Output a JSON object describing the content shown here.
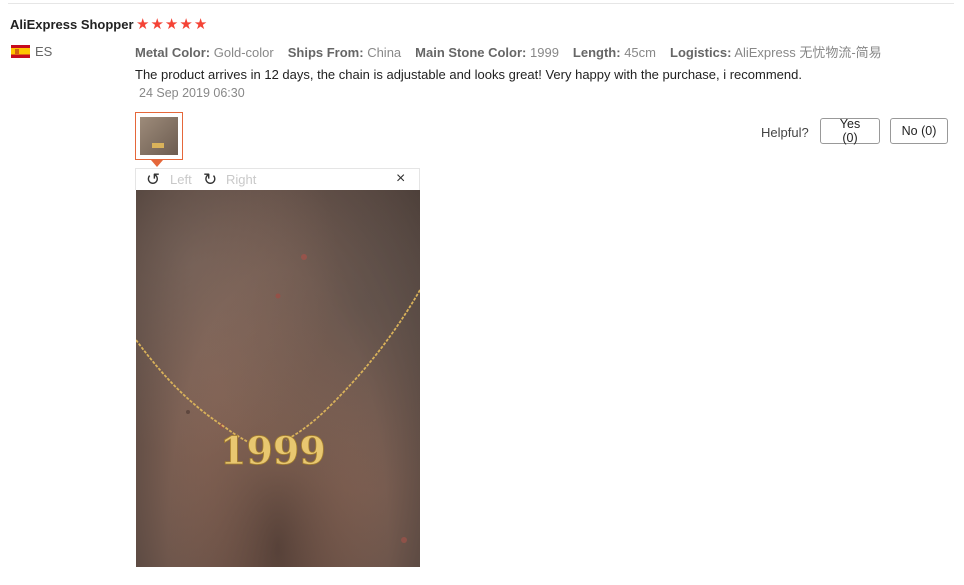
{
  "review": {
    "user_name": "AliExpress Shopper",
    "rating": 5,
    "country": "ES",
    "attributes": [
      {
        "key": "Metal Color:",
        "value": "Gold-color"
      },
      {
        "key": "Ships From:",
        "value": "China"
      },
      {
        "key": "Main Stone Color:",
        "value": "1999"
      },
      {
        "key": "Length:",
        "value": "45cm"
      },
      {
        "key": "Logistics:",
        "value": "AliExpress 无忧物流-简易"
      }
    ],
    "text": "The product arrives in 12 days, the chain is adjustable and looks great! Very happy with the purchase, i recommend.",
    "date": "24 Sep 2019 06:30"
  },
  "helpful": {
    "label": "Helpful?",
    "yes_label": "Yes (0)",
    "no_label": "No (0)"
  },
  "viewer": {
    "rotate_left_label": "Left",
    "rotate_right_label": "Right",
    "close_glyph": "×",
    "pendant_text": "1999"
  },
  "icons": {
    "star": "star-icon",
    "flag": "spain-flag-icon",
    "rotate_left": "rotate-left-icon",
    "rotate_right": "rotate-right-icon",
    "close": "close-icon"
  },
  "colors": {
    "star": "#f44336",
    "thumb_border": "#e5673a",
    "muted_label": "#c9c9c9"
  }
}
